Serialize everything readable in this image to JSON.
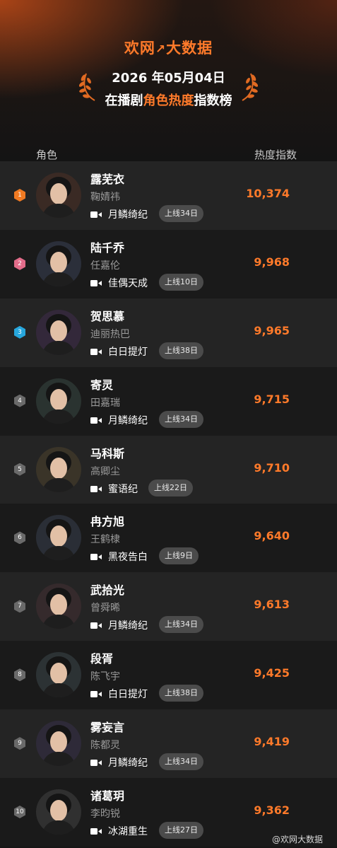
{
  "header": {
    "logo_left": "欢网",
    "logo_arrow": "↗",
    "logo_right": "大数据",
    "date": "2026 年05月04日",
    "title_prefix": "在播剧",
    "title_highlight": "角色热度",
    "title_suffix": "指数榜",
    "col_role": "角色",
    "col_heat": "热度指数",
    "accent_color": "#ff7a2a"
  },
  "rows": [
    {
      "rank": "1",
      "role": "露芜衣",
      "actor": "鞠婧祎",
      "drama": "月鳞绮纪",
      "days": "上线34日",
      "score": "10,374"
    },
    {
      "rank": "2",
      "role": "陆千乔",
      "actor": "任嘉伦",
      "drama": "佳偶天成",
      "days": "上线10日",
      "score": "9,968"
    },
    {
      "rank": "3",
      "role": "贺思慕",
      "actor": "迪丽热巴",
      "drama": "白日提灯",
      "days": "上线38日",
      "score": "9,965"
    },
    {
      "rank": "4",
      "role": "寄灵",
      "actor": "田嘉瑞",
      "drama": "月鳞绮纪",
      "days": "上线34日",
      "score": "9,715"
    },
    {
      "rank": "5",
      "role": "马科斯",
      "actor": "高卿尘",
      "drama": "蜜语纪",
      "days": "上线22日",
      "score": "9,710"
    },
    {
      "rank": "6",
      "role": "冉方旭",
      "actor": "王鹤棣",
      "drama": "黑夜告白",
      "days": "上线9日",
      "score": "9,640"
    },
    {
      "rank": "7",
      "role": "武拾光",
      "actor": "曾舜晞",
      "drama": "月鳞绮纪",
      "days": "上线34日",
      "score": "9,613"
    },
    {
      "rank": "8",
      "role": "段胥",
      "actor": "陈飞宇",
      "drama": "白日提灯",
      "days": "上线38日",
      "score": "9,425"
    },
    {
      "rank": "9",
      "role": "雾妄言",
      "actor": "陈都灵",
      "drama": "月鳞绮纪",
      "days": "上线34日",
      "score": "9,419"
    },
    {
      "rank": "10",
      "role": "诸葛玥",
      "actor": "李昀锐",
      "drama": "冰湖重生",
      "days": "上线27日",
      "score": "9,362"
    }
  ],
  "watermark": "@欢网大数据"
}
